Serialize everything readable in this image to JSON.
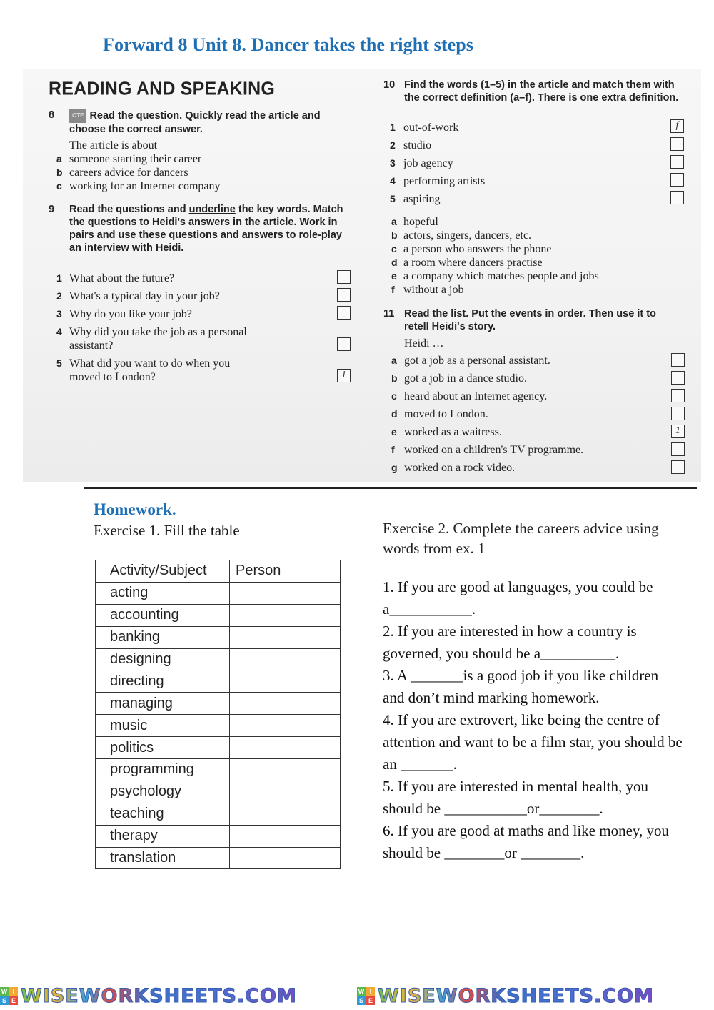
{
  "title": "Forward 8 Unit 8. Dancer takes the right steps",
  "textbook": {
    "heading": "READING AND SPEAKING",
    "ex8": {
      "number": "8",
      "badge": "OTE",
      "instruction": "Read the question. Quickly read the article and choose the correct answer.",
      "stem": "The article is about",
      "options": [
        {
          "label": "a",
          "text": "someone starting their career"
        },
        {
          "label": "b",
          "text": "careers advice for dancers"
        },
        {
          "label": "c",
          "text": "working for an Internet company"
        }
      ]
    },
    "ex9": {
      "number": "9",
      "instruction_pre": "Read the questions and ",
      "instruction_underlined": "underline",
      "instruction_post": " the key words. Match the questions to Heidi's answers in the article. Work in pairs and use these questions and answers to role-play an interview with Heidi.",
      "items": [
        {
          "num": "1",
          "line1": "What about the future?",
          "line2": "",
          "answer": ""
        },
        {
          "num": "2",
          "line1": "What's a typical day in your job?",
          "line2": "",
          "answer": ""
        },
        {
          "num": "3",
          "line1": "Why do you like your job?",
          "line2": "",
          "answer": ""
        },
        {
          "num": "4",
          "line1": "Why did you take the job as a personal",
          "line2": "assistant?",
          "answer": ""
        },
        {
          "num": "5",
          "line1": "What did you want to do when you",
          "line2": "moved to London?",
          "answer": "1"
        }
      ]
    },
    "ex10": {
      "number": "10",
      "instruction": "Find the words (1–5) in the article and match them with the correct definition (a–f). There is one extra definition.",
      "words": [
        {
          "num": "1",
          "text": "out-of-work",
          "answer": "f"
        },
        {
          "num": "2",
          "text": "studio",
          "answer": ""
        },
        {
          "num": "3",
          "text": "job agency",
          "answer": ""
        },
        {
          "num": "4",
          "text": "performing artists",
          "answer": ""
        },
        {
          "num": "5",
          "text": "aspiring",
          "answer": ""
        }
      ],
      "definitions": [
        {
          "label": "a",
          "text": "hopeful"
        },
        {
          "label": "b",
          "text": "actors, singers, dancers, etc."
        },
        {
          "label": "c",
          "text": "a person who answers the phone"
        },
        {
          "label": "d",
          "text": "a room where dancers practise"
        },
        {
          "label": "e",
          "text": "a company which matches people and jobs"
        },
        {
          "label": "f",
          "text": "without a job"
        }
      ]
    },
    "ex11": {
      "number": "11",
      "instruction": "Read the list. Put the events in order. Then use it to retell Heidi's story.",
      "stem": "Heidi …",
      "events": [
        {
          "label": "a",
          "text": "got a job as a personal assistant.",
          "answer": ""
        },
        {
          "label": "b",
          "text": "got a job in a dance studio.",
          "answer": ""
        },
        {
          "label": "c",
          "text": "heard about an Internet agency.",
          "answer": ""
        },
        {
          "label": "d",
          "text": "moved to London.",
          "answer": ""
        },
        {
          "label": "e",
          "text": "worked as a waitress.",
          "answer": "1"
        },
        {
          "label": "f",
          "text": "worked on a children's TV programme.",
          "answer": ""
        },
        {
          "label": "g",
          "text": "worked on a rock video.",
          "answer": ""
        }
      ]
    }
  },
  "homework": {
    "title": "Homework.",
    "exercise1": {
      "instruction": "Exercise 1. Fill the table",
      "headers": [
        "Activity/Subject",
        "Person"
      ],
      "rows": [
        "acting",
        "accounting",
        "banking",
        "designing",
        "directing",
        "managing",
        "music",
        "politics",
        "programming",
        "psychology",
        "teaching",
        "therapy",
        "translation"
      ]
    },
    "exercise2": {
      "instruction": "Exercise 2. Complete the careers advice using words from ex. 1",
      "items": [
        "1. If you are good at languages, you could be a___________.",
        "2. If you are interested in how a country is governed, you should be a__________.",
        "3. A _______is a good job if you like children and don’t mind marking homework.",
        "4. If you are extrovert, like being the centre of attention and want to be a film star, you should be an _______.",
        "5. If you are interested in mental health, you should be ___________or________.",
        "6. If you are good at maths and like money, you should be ________or ________."
      ]
    }
  },
  "footer": {
    "logo_letters": [
      "W",
      "I",
      "S",
      "E"
    ],
    "logo_colors": [
      "#5bb84a",
      "#f2a833",
      "#2f9ad6",
      "#e84a3c"
    ],
    "watermark": "WISEWORKSHEETS.COM"
  }
}
